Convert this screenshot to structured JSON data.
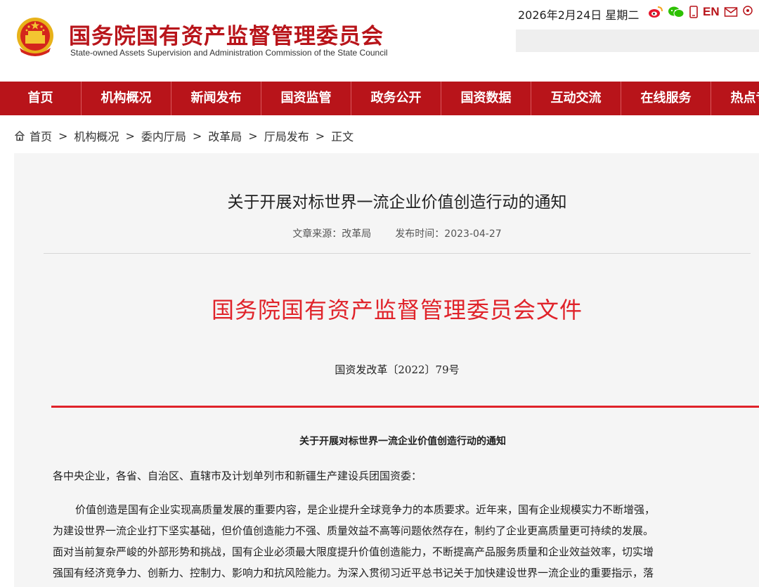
{
  "header": {
    "site_title": "国务院国有资产监督管理委员会",
    "site_subtitle": "State-owned Assets Supervision and Administration Commission of the State Council",
    "date_text": "2026年2月24日 星期二",
    "lang_link": "EN",
    "icons": [
      "weibo-icon",
      "wechat-icon",
      "mobile-icon",
      "mail-icon",
      "location-icon"
    ],
    "brand_color": "#b8141a"
  },
  "nav": {
    "items": [
      "首页",
      "机构概况",
      "新闻发布",
      "国资监管",
      "政务公开",
      "国资数据",
      "互动交流",
      "在线服务",
      "热点专题"
    ]
  },
  "breadcrumb": {
    "items": [
      "首页",
      "机构概况",
      "委内厅局",
      "改革局",
      "厅局发布"
    ],
    "current": "正文",
    "separator": ">"
  },
  "article": {
    "title": "关于开展对标世界一流企业价值创造行动的通知",
    "source_label": "文章来源：改革局",
    "date_label": "发布时间：2023-04-27",
    "doc_header": "国务院国有资产监督管理委员会文件",
    "doc_number": "国资发改革〔2022〕79号",
    "notice_title": "关于开展对标世界一流企业价值创造行动的通知",
    "addressee": "各中央企业，各省、自治区、直辖市及计划单列市和新疆生产建设兵团国资委：",
    "body_lines": [
      "价值创造是国有企业实现高质量发展的重要内容，是企业提升全球竞争力的本质要求。近年来，国有企业规模实力不断增强，",
      "为建设世界一流企业打下坚实基础，但价值创造能力不强、质量效益不高等问题依然存在，制约了企业更高质量更可持续的发展。",
      "面对当前复杂严峻的外部形势和挑战，国有企业必须最大限度提升价值创造能力，不断提高产品服务质量和企业效益效率，切实增",
      "强国有经济竞争力、创新力、控制力、影响力和抗风险能力。为深入贯彻习近平总书记关于加快建设世界一流企业的重要指示，落"
    ],
    "doc_color": "#e0232a"
  }
}
